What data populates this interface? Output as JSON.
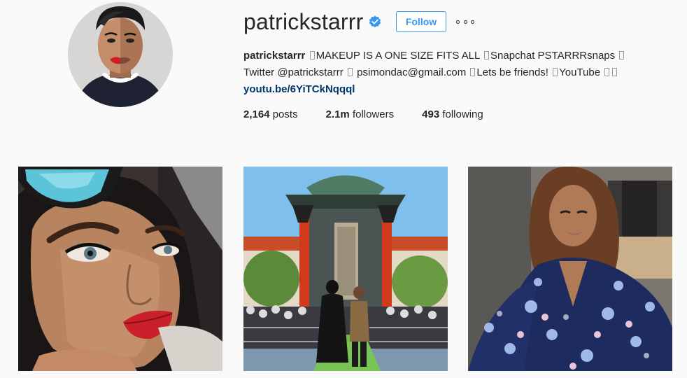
{
  "profile": {
    "username": "patrickstarrr",
    "follow_label": "Follow",
    "verified": true
  },
  "bio": {
    "name": "patrickstarrr",
    "segment1": "MAKEUP IS A ONE SIZE FITS ALL",
    "segment2": "Snapchat PSTARRRsnaps",
    "segment3": "Twitter",
    "twitter_handle": "@patrickstarrr",
    "segment4": "psimondac@gmail.com",
    "segment5": "Lets be friends!",
    "segment6": "YouTube",
    "link": "youtu.be/6YiTCkNqqql"
  },
  "stats": {
    "posts_count": "2,164",
    "posts_label": "posts",
    "followers_count": "2.1m",
    "followers_label": "followers",
    "following_count": "493",
    "following_label": "following"
  },
  "colors": {
    "accent": "#3897f0",
    "link": "#003569",
    "background": "#fafafa",
    "text": "#262626"
  },
  "icons": {
    "verified": "verified-badge-icon",
    "more": "more-options-icon"
  }
}
